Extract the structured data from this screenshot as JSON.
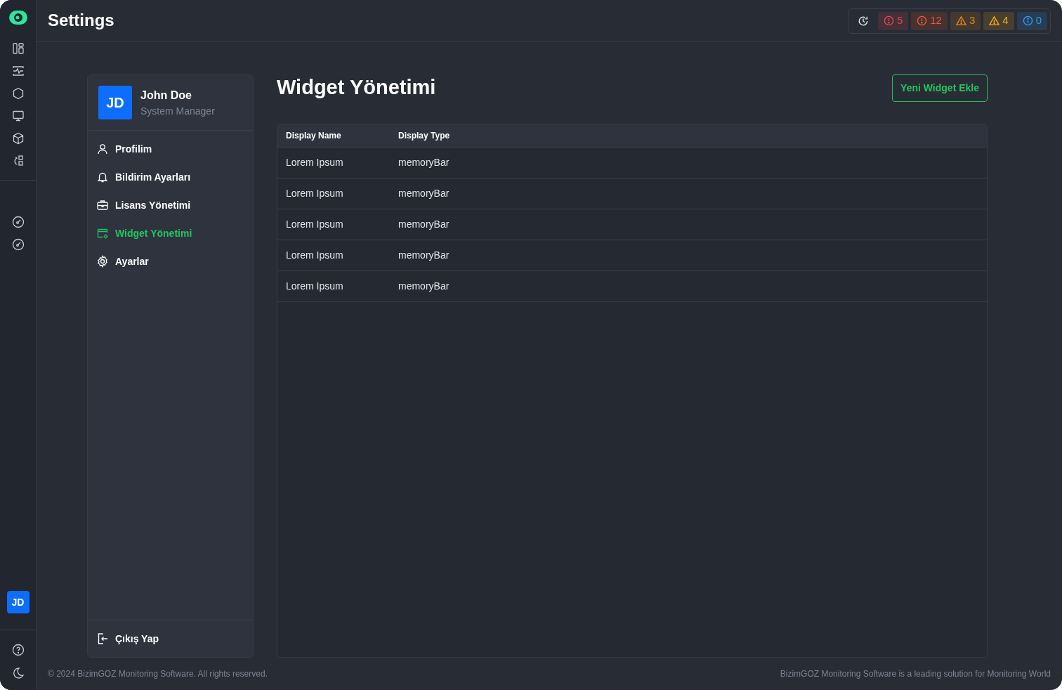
{
  "header": {
    "title": "Settings"
  },
  "status_badges": [
    {
      "kind": "error",
      "color": "#e5484d",
      "count": "5"
    },
    {
      "kind": "error",
      "color": "#f0592a",
      "count": "12"
    },
    {
      "kind": "warning",
      "color": "#e5870e",
      "count": "3"
    },
    {
      "kind": "warning",
      "color": "#f5b014",
      "count": "4"
    },
    {
      "kind": "info",
      "color": "#2f9bf0",
      "count": "0"
    }
  ],
  "rail": {
    "avatar": "JD"
  },
  "profile": {
    "initials": "JD",
    "name": "John Doe",
    "role": "System Manager"
  },
  "menu": [
    {
      "kind": "person",
      "label": "Profilim",
      "selected": false
    },
    {
      "kind": "bell",
      "label": "Bildirim Ayarları",
      "selected": false
    },
    {
      "kind": "briefcase",
      "label": "Lisans Yönetimi",
      "selected": false
    },
    {
      "kind": "widget",
      "label": "Widget Yönetimi",
      "selected": true
    },
    {
      "kind": "gear",
      "label": "Ayarlar",
      "selected": false
    }
  ],
  "logout": {
    "label": "Çıkış Yap"
  },
  "page": {
    "title": "Widget Yönetimi",
    "add_button": "Yeni Widget Ekle"
  },
  "table": {
    "columns": [
      "Display Name",
      "Display Type"
    ],
    "rows": [
      [
        "Lorem Ipsum",
        "memoryBar"
      ],
      [
        "Lorem Ipsum",
        "memoryBar"
      ],
      [
        "Lorem Ipsum",
        "memoryBar"
      ],
      [
        "Lorem Ipsum",
        "memoryBar"
      ],
      [
        "Lorem Ipsum",
        "memoryBar"
      ]
    ]
  },
  "footer": {
    "copyright": "© 2024 BizimGOZ Monitoring Software. All rights reserved.",
    "tagline": "BizimGOZ Monitoring Software is a leading solution for Monitoring World"
  }
}
